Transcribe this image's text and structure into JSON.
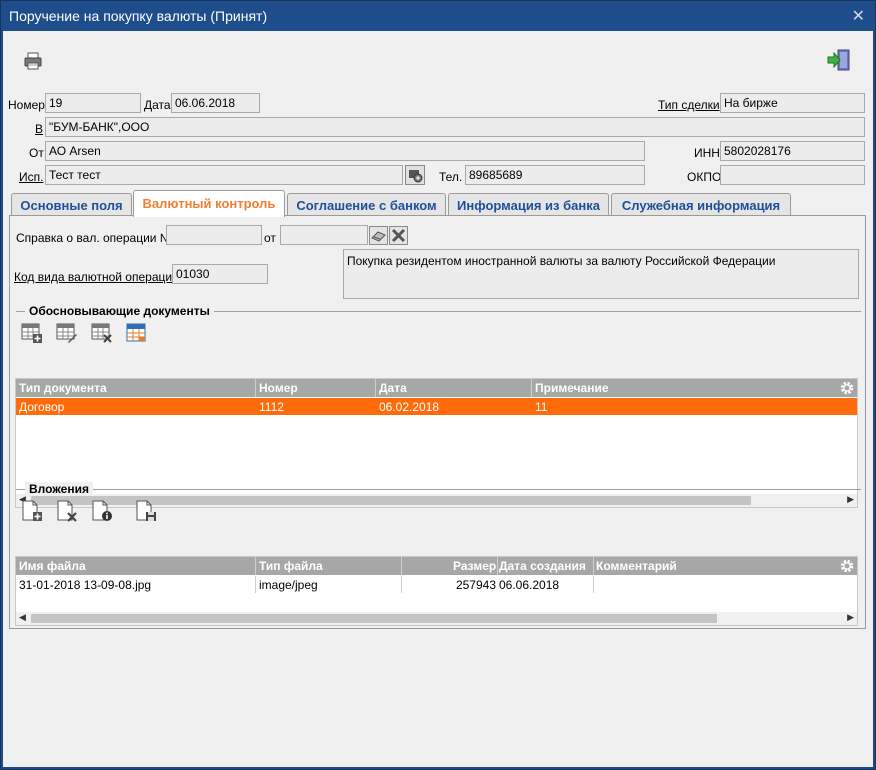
{
  "window": {
    "title": "Поручение на покупку валюты (Принят)"
  },
  "toolbar": {
    "print_icon": "printer-icon",
    "exit_icon": "exit-door-icon"
  },
  "header": {
    "number_label": "Номер",
    "number_value": "19",
    "date_label": "Дата",
    "date_value": "06.06.2018",
    "deal_type_label": "Тип сделки",
    "deal_type_value": "На бирже",
    "bank_label": "В",
    "bank_value": "\"БУМ-БАНК\",ООО",
    "from_label": "От",
    "from_value": "АО Arsen",
    "inn_label": "ИНН",
    "inn_value": "5802028176",
    "executor_label": "Исп.",
    "executor_value": "Тест тест",
    "phone_label": "Тел.",
    "phone_value": "89685689",
    "okpo_label": "ОКПО",
    "okpo_value": ""
  },
  "tabs": [
    {
      "label": "Основные поля",
      "active": false
    },
    {
      "label": "Валютный контроль",
      "active": true
    },
    {
      "label": "Соглашение с банком",
      "active": false
    },
    {
      "label": "Информация из банка",
      "active": false
    },
    {
      "label": "Служебная информация",
      "active": false
    }
  ],
  "currency_control": {
    "certificate_label": "Справка о вал. операции №",
    "certificate_value": "",
    "from_label": "от",
    "from_value": "",
    "op_code_label": "Код вида валютной операции",
    "op_code_value": "01030",
    "op_description": "Покупка резидентом иностранной валюты за валюту Российской Федерации"
  },
  "documents": {
    "section_title": "Обосновывающие документы",
    "columns": [
      "Тип документа",
      "Номер",
      "Дата",
      "Примечание"
    ],
    "rows": [
      {
        "type": "Договор",
        "number": "1112",
        "date": "06.02.2018",
        "note": "11"
      }
    ]
  },
  "attachments": {
    "section_title": "Вложения",
    "columns": [
      "Имя файла",
      "Тип файла",
      "Размер",
      "Дата создания",
      "Комментарий"
    ],
    "rows": [
      {
        "name": "31-01-2018 13-09-08.jpg",
        "type": "image/jpeg",
        "size": "257943",
        "created": "06.06.2018",
        "comment": ""
      }
    ]
  },
  "colors": {
    "title_bar": "#1e4d8b",
    "tab_text": "#1f4f9a",
    "tab_active_text": "#f08030",
    "selected_row": "#ff6a0a",
    "grid_header": "#a7a7a7"
  }
}
